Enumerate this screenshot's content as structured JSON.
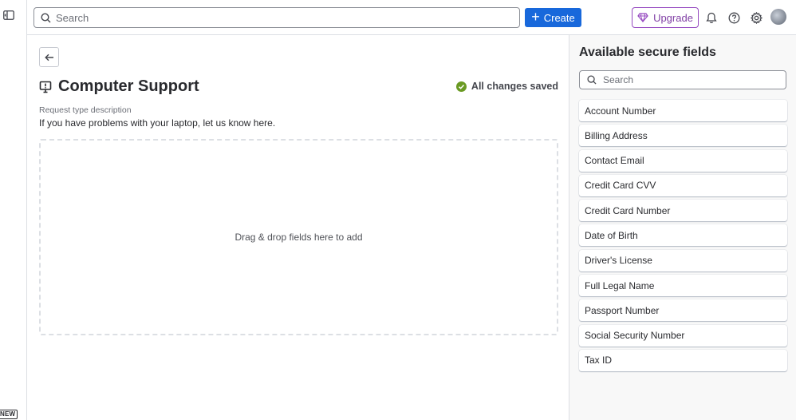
{
  "rail": {
    "new_badge": "NEW"
  },
  "topbar": {
    "search_placeholder": "Search",
    "create_label": "Create",
    "upgrade_label": "Upgrade"
  },
  "page": {
    "title": "Computer Support",
    "status": "All changes saved",
    "description_label": "Request type description",
    "description": "If you have problems with your laptop, let us know here.",
    "dropzone_text": "Drag & drop fields here to add"
  },
  "sidebar": {
    "title": "Available secure fields",
    "search_placeholder": "Search",
    "fields": [
      "Account Number",
      "Billing Address",
      "Contact Email",
      "Credit Card CVV",
      "Credit Card Number",
      "Date of Birth",
      "Driver's License",
      "Full Legal Name",
      "Passport Number",
      "Social Security Number",
      "Tax ID"
    ]
  },
  "colors": {
    "primary": "#1868db",
    "upgrade": "#803fa5",
    "success": "#6a9a23"
  }
}
